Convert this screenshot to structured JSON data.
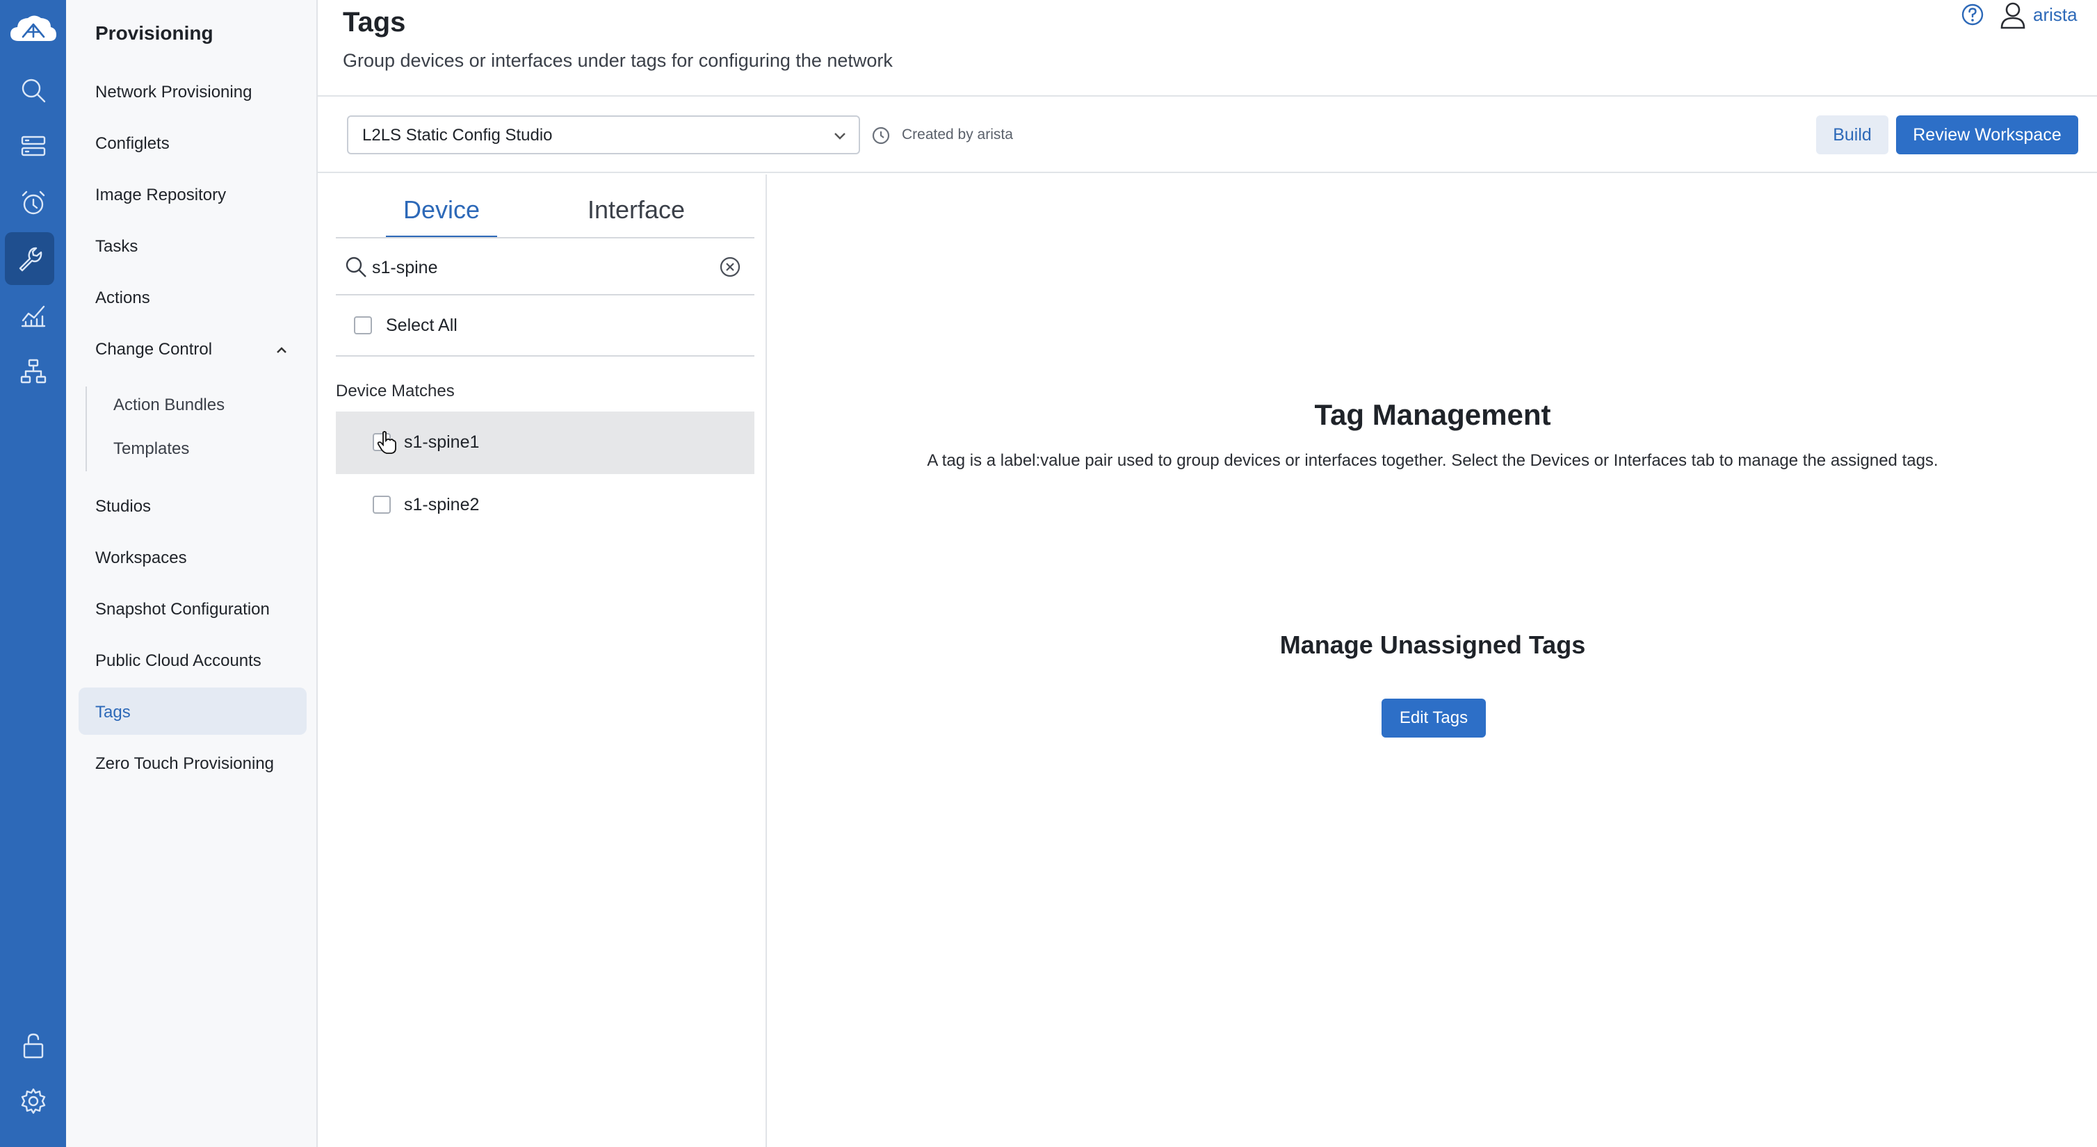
{
  "app": {
    "user": "arista",
    "help_icon": "help-icon",
    "user_icon": "user-icon"
  },
  "rail": {
    "items": [
      "cloudvision-logo",
      "search-icon",
      "devices-icon",
      "events-icon",
      "provisioning-icon",
      "dashboards-icon",
      "topology-icon",
      "unlock-icon",
      "gear-icon"
    ],
    "active": "provisioning-icon"
  },
  "sidebar": {
    "title": "Provisioning",
    "items": [
      {
        "label": "Network Provisioning"
      },
      {
        "label": "Configlets"
      },
      {
        "label": "Image Repository"
      },
      {
        "label": "Tasks"
      },
      {
        "label": "Actions"
      },
      {
        "label": "Change Control"
      },
      {
        "label": "Studios"
      },
      {
        "label": "Workspaces"
      },
      {
        "label": "Snapshot Configuration"
      },
      {
        "label": "Public Cloud Accounts"
      },
      {
        "label": "Tags"
      },
      {
        "label": "Zero Touch Provisioning"
      }
    ],
    "sub_items": [
      {
        "label": "Action Bundles"
      },
      {
        "label": "Templates"
      }
    ],
    "selected": "Tags"
  },
  "header": {
    "title": "Tags",
    "description": "Group devices or interfaces under tags for configuring the network"
  },
  "toolbar": {
    "workspace": "L2LS Static Config Studio",
    "created_by": "Created by arista",
    "build_label": "Build",
    "review_label": "Review Workspace"
  },
  "panel": {
    "tabs": [
      {
        "label": "Device",
        "active": true
      },
      {
        "label": "Interface",
        "active": false
      }
    ],
    "search": {
      "value": "s1-spine"
    },
    "select_all": "Select All",
    "matches_heading": "Device Matches",
    "devices": [
      {
        "name": "s1-spine1",
        "hovered": true
      },
      {
        "name": "s1-spine2",
        "hovered": false
      }
    ]
  },
  "main": {
    "tag_management_title": "Tag Management",
    "tag_management_desc": "A tag is a label:value pair used to group devices or interfaces together. Select the Devices or Interfaces tab to manage the assigned tags.",
    "unassigned_title": "Manage Unassigned Tags",
    "edit_tags_label": "Edit Tags"
  },
  "colors": {
    "rail": "#2d69b8",
    "accent": "#2d6fc7",
    "selected_nav": "#e4eaf3"
  }
}
